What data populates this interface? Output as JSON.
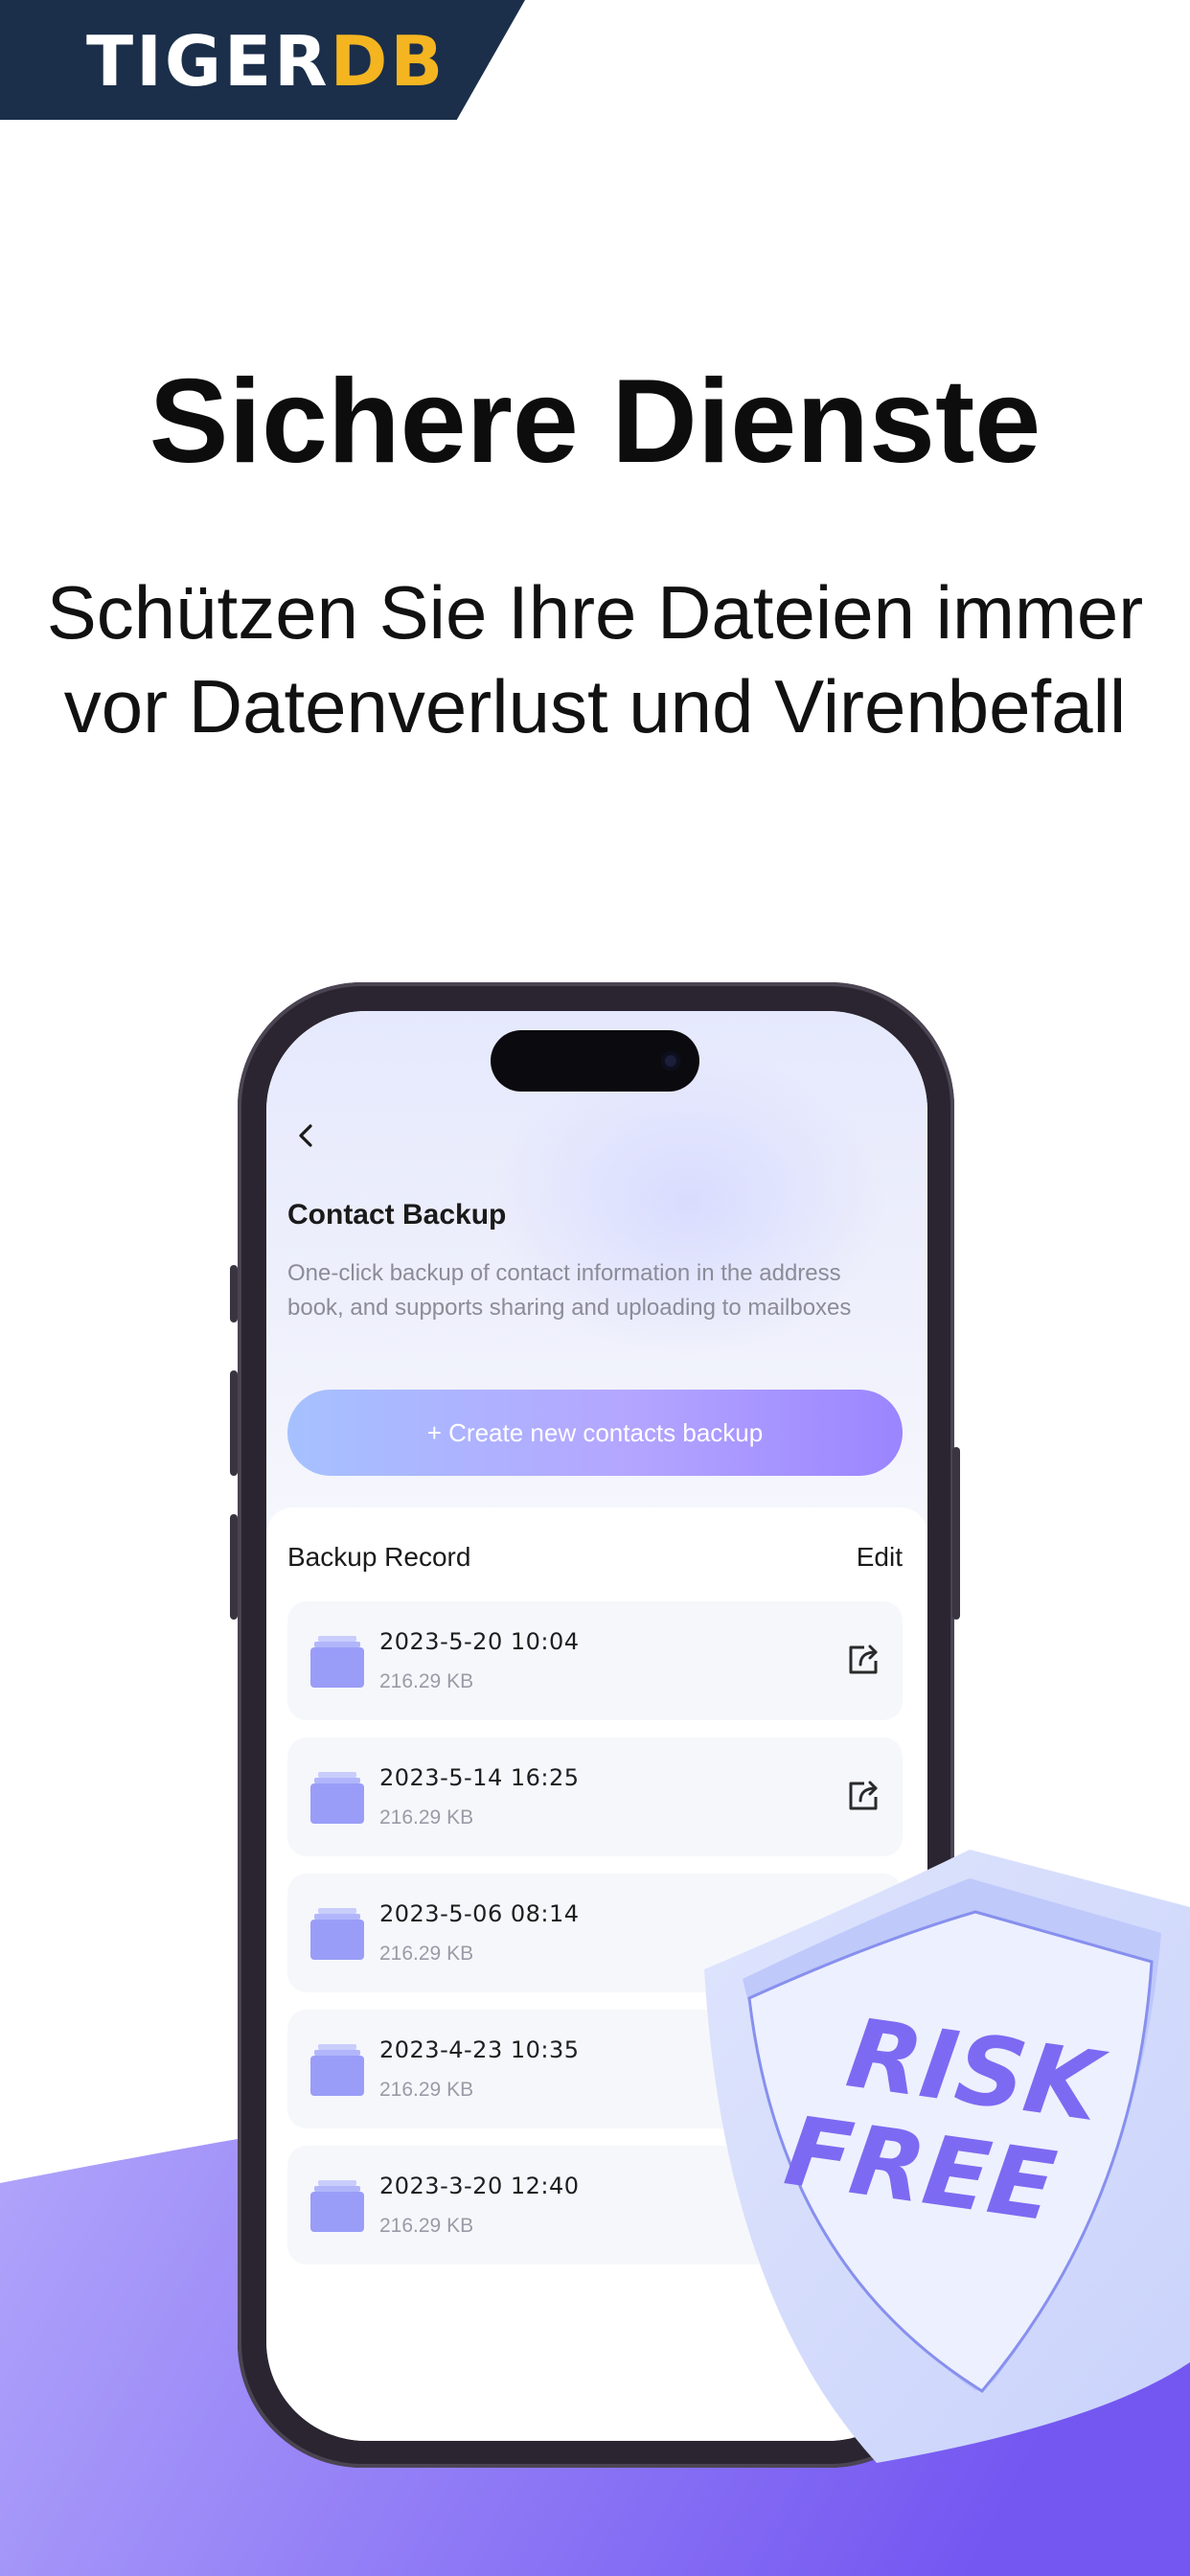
{
  "brand": {
    "word_a": "TIGER",
    "word_b": "DB"
  },
  "headline": "Sichere Dienste",
  "subline": {
    "line1": "Schützen Sie Ihre Dateien immer",
    "line2": "vor Datenverlust und Virenbefall"
  },
  "screen": {
    "title": "Contact Backup",
    "description": "One-click backup of contact information in the address book, and supports sharing and uploading to mailboxes",
    "create_button": "+ Create new contacts backup",
    "records_title": "Backup Record",
    "edit_label": "Edit",
    "records": [
      {
        "date": "2023-5-20 10:04",
        "size": "216.29 KB"
      },
      {
        "date": "2023-5-14 16:25",
        "size": "216.29 KB"
      },
      {
        "date": "2023-5-06 08:14",
        "size": "216.29 KB"
      },
      {
        "date": "2023-4-23 10:35",
        "size": "216.29 KB"
      },
      {
        "date": "2023-3-20 12:40",
        "size": "216.29 KB"
      }
    ]
  },
  "badge": {
    "line1": "RISK",
    "line2": "FREE"
  },
  "colors": {
    "brand_navy": "#1b2f4b",
    "brand_gold": "#f4b521",
    "accent_purple": "#7d6af2",
    "wave_start": "#b0a4fb",
    "wave_end": "#7358f0"
  }
}
